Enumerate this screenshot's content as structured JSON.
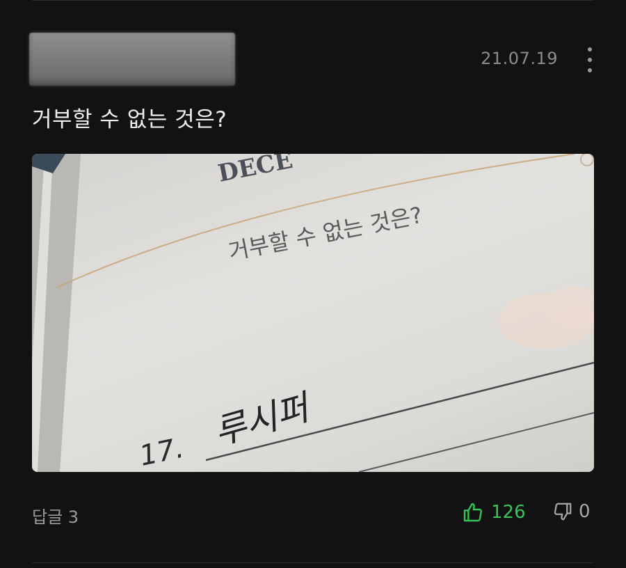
{
  "comment": {
    "date": "21.07.19",
    "text": "거부할 수 없는 것은?",
    "reply_label": "답글 3",
    "likes": "126",
    "dislikes": "0"
  },
  "photo": {
    "header_word": "DECE",
    "printed_question": "거부할 수 없는 것은?",
    "handwritten_number": "17.",
    "handwritten_answer": "루시퍼"
  },
  "icons": {
    "more": "more-vertical-icon",
    "like": "thumbs-up-icon",
    "dislike": "thumbs-down-icon"
  },
  "colors": {
    "background": "#121212",
    "like_accent": "#37c25b",
    "muted_text": "#8d8d8d"
  }
}
